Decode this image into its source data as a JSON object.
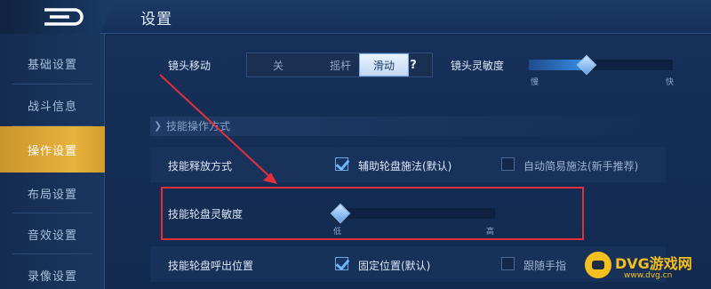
{
  "header": {
    "title": "设置"
  },
  "sidebar": {
    "items": [
      {
        "label": "基础设置"
      },
      {
        "label": "战斗信息"
      },
      {
        "label": "操作设置"
      },
      {
        "label": "布局设置"
      },
      {
        "label": "音效设置"
      },
      {
        "label": "录像设置"
      }
    ],
    "active_index": 2
  },
  "camera": {
    "label": "镜头移动",
    "options": [
      "关",
      "摇杆",
      "滑动"
    ],
    "selected": "滑动",
    "help": "?",
    "sensitivity_label": "镜头灵敏度",
    "sensitivity_value": 0.4,
    "min_label": "慢",
    "max_label": "快"
  },
  "skill_section": {
    "title": "技能操作方式"
  },
  "cast_mode": {
    "label": "技能释放方式",
    "option1": {
      "label": "辅助轮盘施法(默认)",
      "checked": true
    },
    "option2": {
      "label": "自动简易施法(新手推荐)",
      "checked": false
    }
  },
  "wheel_sensitivity": {
    "label": "技能轮盘灵敏度",
    "value": 0.0,
    "min_label": "低",
    "max_label": "高"
  },
  "wheel_position": {
    "label": "技能轮盘呼出位置",
    "option1": {
      "label": "固定位置(默认)",
      "checked": true
    },
    "option2": {
      "label": "跟随手指",
      "checked": false
    }
  },
  "watermark": {
    "text": "DVG游戏网",
    "sub": "www.dvg.cn"
  },
  "colors": {
    "accent": "#e8b23d",
    "highlight": "#e0313a",
    "slider": "#3a8ee6"
  }
}
